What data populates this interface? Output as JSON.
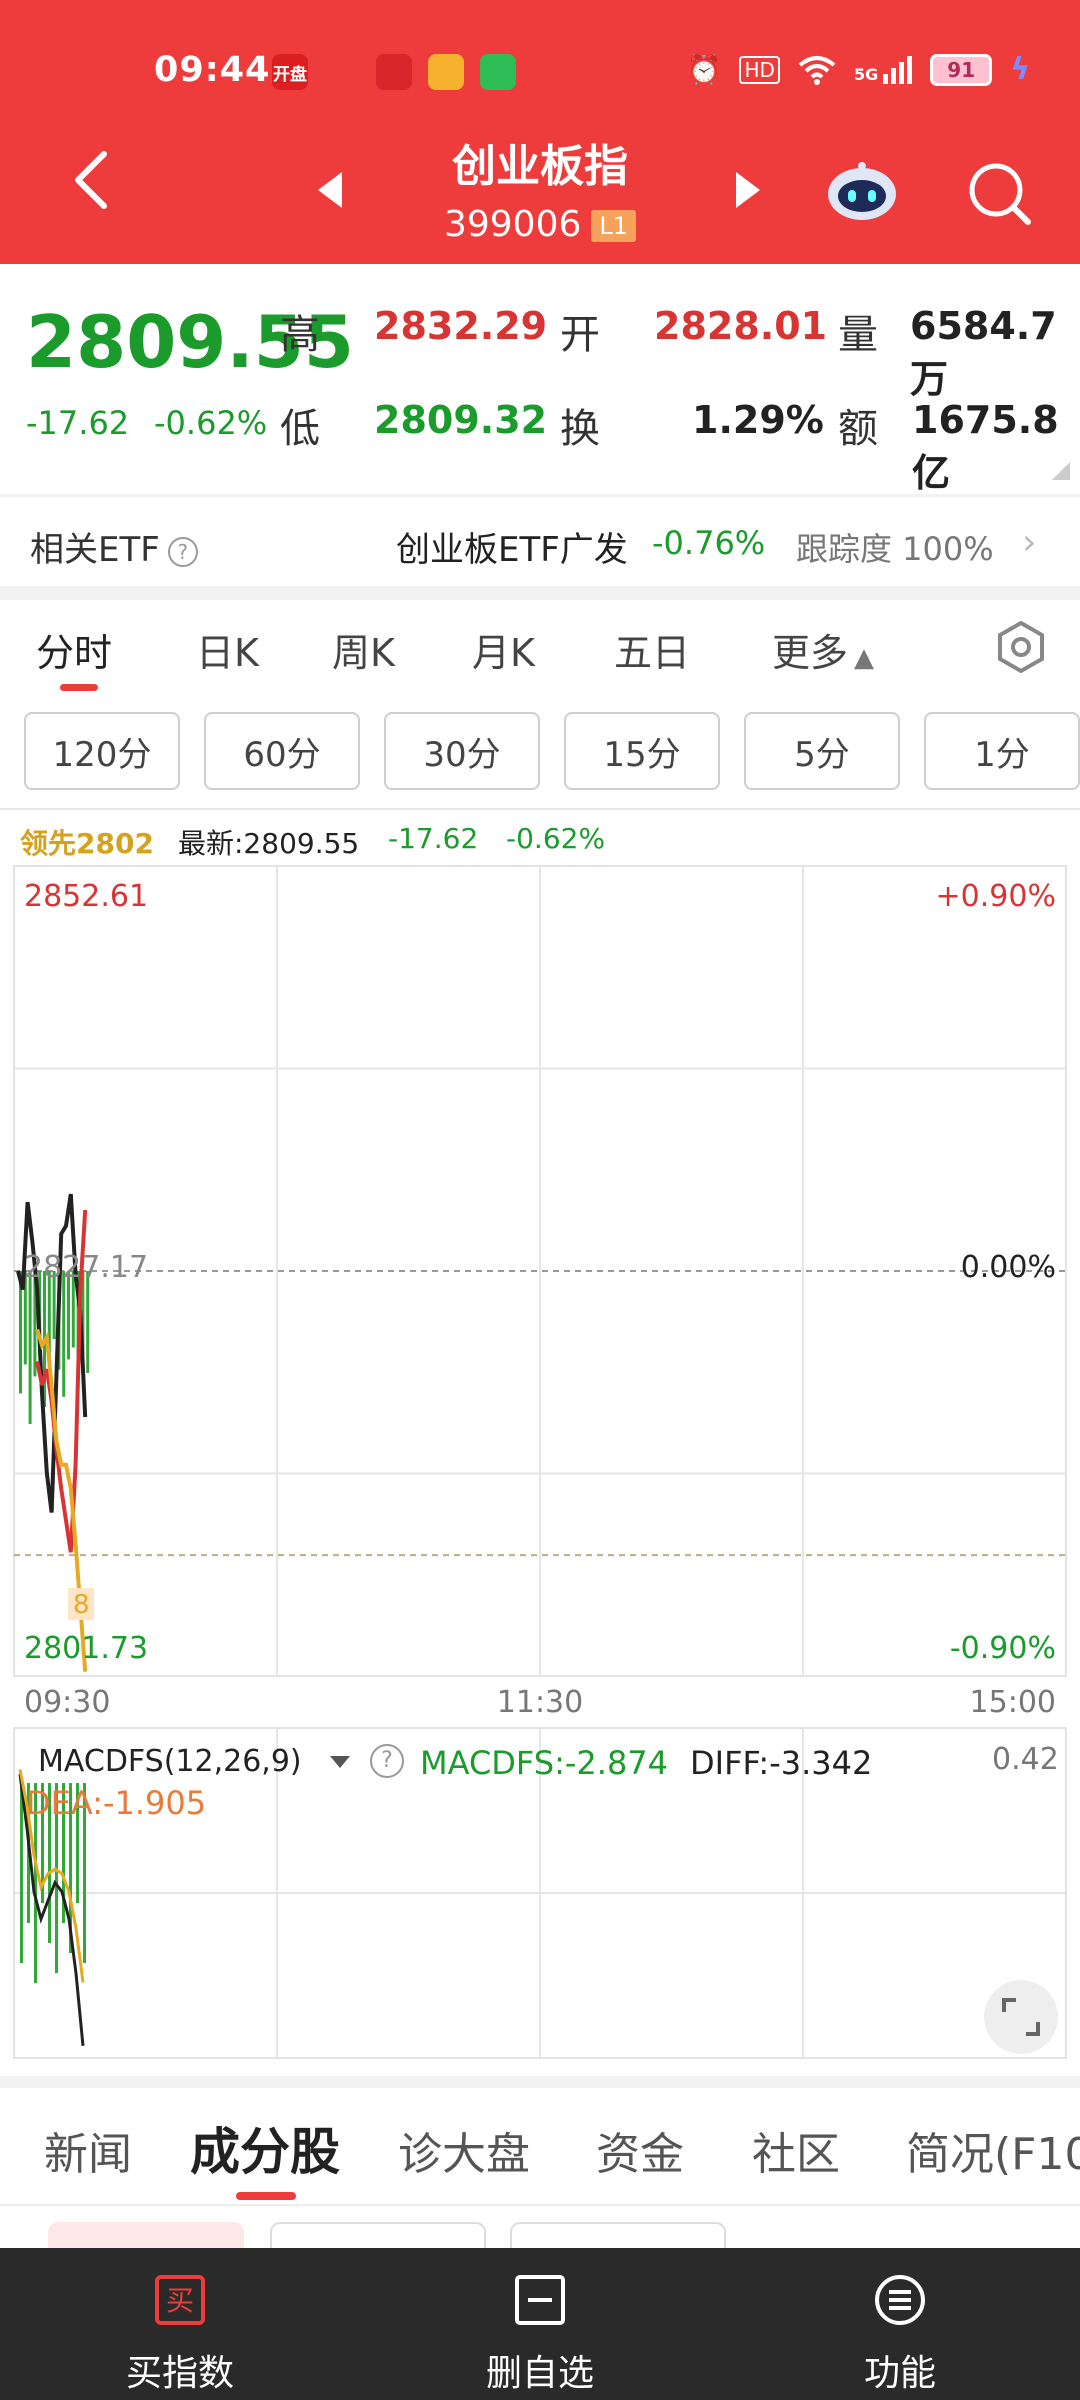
{
  "status_bar": {
    "time": "09:44",
    "apps": [
      {
        "name": "kaipan-app-icon",
        "label": "开盘",
        "bg": "#d91f1f",
        "fg": "#fff"
      },
      {
        "name": "huawei-app-icon",
        "label": "",
        "bg": "#ee3b3c",
        "fg": "#fff"
      },
      {
        "name": "securities-app-icon",
        "label": "",
        "bg": "#d9262a",
        "fg": "#fff"
      },
      {
        "name": "video-app-icon",
        "label": "",
        "bg": "#f7b22f",
        "fg": "#fff"
      },
      {
        "name": "chat-app-icon",
        "label": "",
        "bg": "#2ebd57",
        "fg": "#fff"
      }
    ],
    "hd": "HD",
    "signal": "5G",
    "battery": "91"
  },
  "header": {
    "title": "创业板指",
    "code": "399006",
    "level_badge": "L1"
  },
  "quote": {
    "price": "2809.55",
    "change": "-17.62",
    "change_pct": "-0.62%",
    "high_label": "高",
    "high": "2832.29",
    "open_label": "开",
    "open": "2828.01",
    "volume_label": "量",
    "volume": "6584.7万",
    "low_label": "低",
    "low": "2809.32",
    "turnover_label": "换",
    "turnover": "1.29%",
    "amount_label": "额",
    "amount": "1675.8亿"
  },
  "etf": {
    "label": "相关ETF",
    "name": "创业板ETF广发",
    "change": "-0.76%",
    "tracking": "跟踪度 100%"
  },
  "period_tabs": [
    "分时",
    "日K",
    "周K",
    "月K",
    "五日",
    "更多"
  ],
  "interval_buttons": [
    "120分",
    "60分",
    "30分",
    "15分",
    "5分",
    "1分"
  ],
  "chart_info": {
    "lead": "领先2802",
    "latest": "最新:2809.55",
    "change": "-17.62",
    "change_pct": "-0.62%"
  },
  "chart_data": [
    {
      "type": "line",
      "title": "",
      "y_ticks": {
        "top": "2852.61",
        "mid": "2827.17",
        "bottom": "2801.73"
      },
      "pct_ticks": {
        "top": "+0.90%",
        "mid": "0.00%",
        "bottom": "-0.90%"
      },
      "x_ticks": [
        "09:30",
        "11:30",
        "15:00"
      ],
      "ylim": [
        2801.73,
        2852.61
      ],
      "baseline": 2827.17,
      "marker_label": "8",
      "series": [
        {
          "name": "",
          "color": "#222222",
          "x": [
            0,
            1,
            2,
            3,
            4,
            5,
            6,
            7,
            8,
            9,
            10,
            11,
            12,
            13,
            14
          ],
          "values": [
            2827.17,
            2826.0,
            2831.5,
            2829.0,
            2826.0,
            2819.5,
            2814.5,
            2812.0,
            2820.5,
            2829.5,
            2830.0,
            2832.0,
            2827.0,
            2824.5,
            2818.0
          ]
        },
        {
          "name": "",
          "color": "#d93434",
          "x": [
            4,
            5,
            6,
            7,
            8,
            9,
            10,
            11,
            12,
            13,
            14
          ],
          "values": [
            2821.5,
            2820.0,
            2821.0,
            2819.0,
            2816.0,
            2813.5,
            2811.5,
            2809.5,
            2815.0,
            2826.0,
            2831.0
          ]
        },
        {
          "name": "",
          "color": "#e8a922",
          "x": [
            4,
            5,
            6,
            7,
            8,
            9,
            10,
            11,
            12,
            13,
            14
          ],
          "values": [
            2823.5,
            2822.5,
            2823.0,
            2820.0,
            2816.5,
            2815.0,
            2815.0,
            2813.5,
            2810.0,
            2806.0,
            2802.0
          ]
        }
      ],
      "volume_bars": [
        0.72,
        0.55,
        0.9,
        0.62,
        0.48,
        0.8,
        0.66,
        0.4,
        0.58,
        0.74,
        0.52,
        0.45,
        0.68,
        0.5,
        0.6
      ],
      "volume_color": "#32a83a"
    },
    {
      "type": "line",
      "title": "",
      "indicator": "MACDFS(12,26,9)",
      "macdfs_label": "MACDFS:-2.874",
      "diff_label": "DIFF:-3.342",
      "dea_label": "DEA:-1.905",
      "ymax_label": "0.42",
      "series": [
        {
          "name": "",
          "color": "#222222",
          "x": [
            0,
            1,
            2,
            3,
            4,
            5,
            6,
            7,
            8,
            9
          ],
          "values": [
            0.2,
            -1.0,
            -2.4,
            -3.0,
            -2.6,
            -2.2,
            -2.4,
            -3.0,
            -4.2,
            -5.8
          ]
        },
        {
          "name": "",
          "color": "#e8a922",
          "x": [
            0,
            1,
            2,
            3,
            4,
            5,
            6,
            7,
            8,
            9
          ],
          "values": [
            0.3,
            -0.5,
            -1.6,
            -2.3,
            -2.0,
            -1.9,
            -2.0,
            -2.4,
            -3.2,
            -4.4
          ]
        }
      ],
      "histogram": [
        0.9,
        0.7,
        1.0,
        0.6,
        0.8,
        0.95,
        0.7,
        0.85,
        0.6,
        0.9
      ],
      "histogram_color": "#32a83a"
    }
  ],
  "macd": {
    "name": "MACDFS(12,26,9)",
    "macdfs": "MACDFS:-2.874",
    "diff": "DIFF:-3.342",
    "dea": "DEA:-1.905",
    "max": "0.42"
  },
  "section_tabs": [
    "新闻",
    "成分股",
    "诊大盘",
    "资金",
    "社区",
    "简况(F10"
  ],
  "bottom_bar": {
    "buy_icon_text": "买",
    "buy": "买指数",
    "remove": "删自选",
    "func": "功能"
  },
  "colors": {
    "brand_red": "#ee3b3c",
    "up_red": "#d93434",
    "down_green": "#1b9b2c",
    "avg_yellow": "#e8a922",
    "bottom_bar": "#2a2a2a"
  }
}
